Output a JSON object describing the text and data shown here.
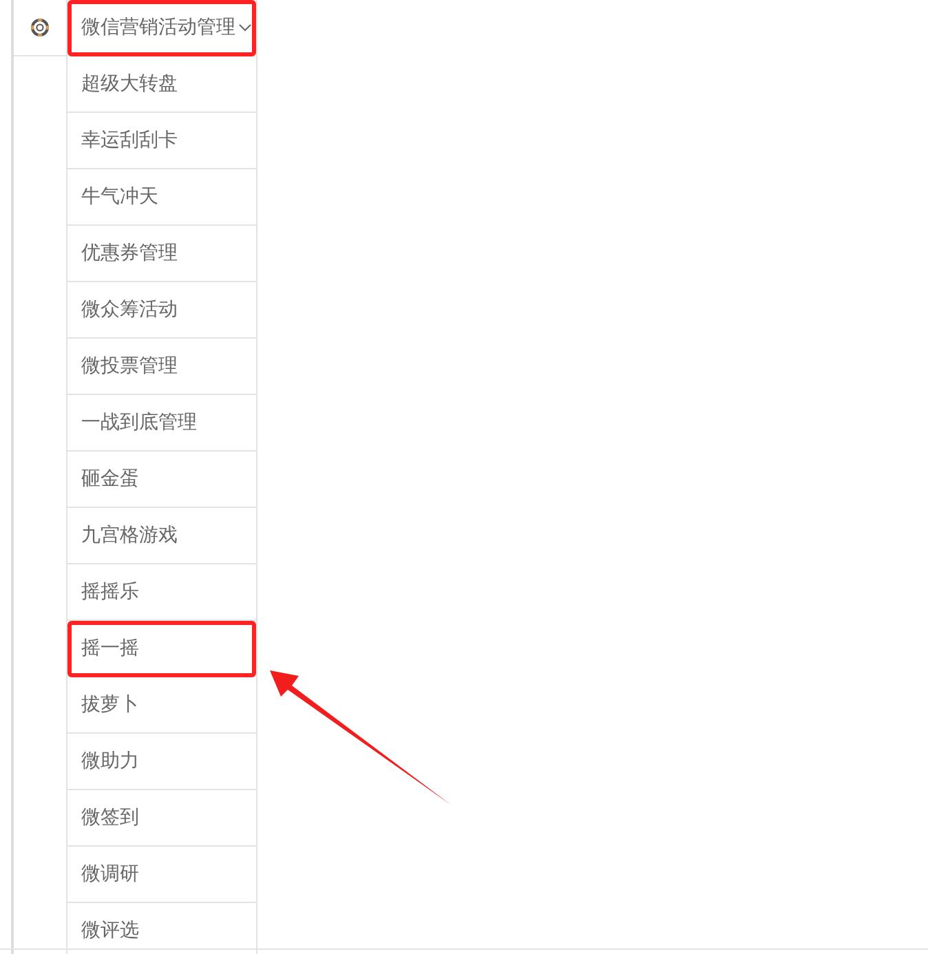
{
  "menu": {
    "title": "微信营销活动管理",
    "expanded": true,
    "highlighted": true,
    "items": [
      {
        "label": "超级大转盘",
        "highlighted": false
      },
      {
        "label": "幸运刮刮卡",
        "highlighted": false
      },
      {
        "label": "牛气冲天",
        "highlighted": false
      },
      {
        "label": "优惠券管理",
        "highlighted": false
      },
      {
        "label": "微众筹活动",
        "highlighted": false
      },
      {
        "label": "微投票管理",
        "highlighted": false
      },
      {
        "label": "一战到底管理",
        "highlighted": false
      },
      {
        "label": "砸金蛋",
        "highlighted": false
      },
      {
        "label": "九宫格游戏",
        "highlighted": false
      },
      {
        "label": "摇摇乐",
        "highlighted": false
      },
      {
        "label": "摇一摇",
        "highlighted": true
      },
      {
        "label": "拔萝卜",
        "highlighted": false
      },
      {
        "label": "微助力",
        "highlighted": false
      },
      {
        "label": "微签到",
        "highlighted": false
      },
      {
        "label": "微调研",
        "highlighted": false
      },
      {
        "label": "微评选",
        "highlighted": false
      }
    ]
  }
}
